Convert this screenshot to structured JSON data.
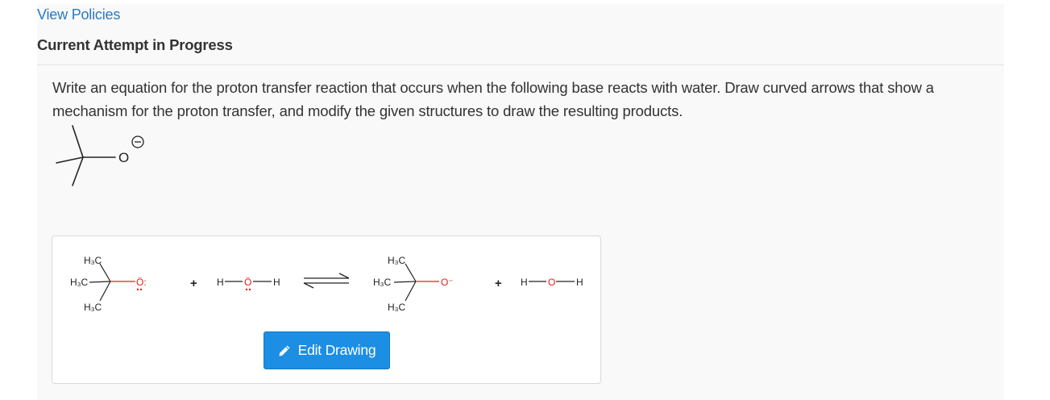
{
  "header": {
    "view_policies_label": "View Policies",
    "attempt_title": "Current Attempt in Progress"
  },
  "question": {
    "text": "Write an equation for the proton transfer reaction that occurs when the following base reacts with water. Draw curved arrows that show a mechanism for the proton transfer, and modify the given structures to draw the resulting products."
  },
  "skeletal": {
    "oxygen_label": "O"
  },
  "reaction": {
    "reactant1": {
      "ch3_top": "H₃C",
      "ch3_left": "H₃C",
      "ch3_bottom": "H₃C",
      "oxygen": "Ö:"
    },
    "plus1": "+",
    "water1": {
      "h_left": "H",
      "oxygen": "Ö",
      "h_right": "H"
    },
    "product1": {
      "ch3_top": "H₃C",
      "ch3_left": "H₃C",
      "ch3_bottom": "H₃C",
      "oxygen": "O⁻"
    },
    "plus2": "+",
    "water2": {
      "h_left": "H",
      "oxygen": "O",
      "h_right": "H"
    }
  },
  "edit_button": {
    "label": "Edit Drawing",
    "icon": "pencil-icon"
  },
  "colors": {
    "link": "#2a7ac1",
    "button": "#1c8ee3",
    "oxygen": "#e0201b"
  }
}
